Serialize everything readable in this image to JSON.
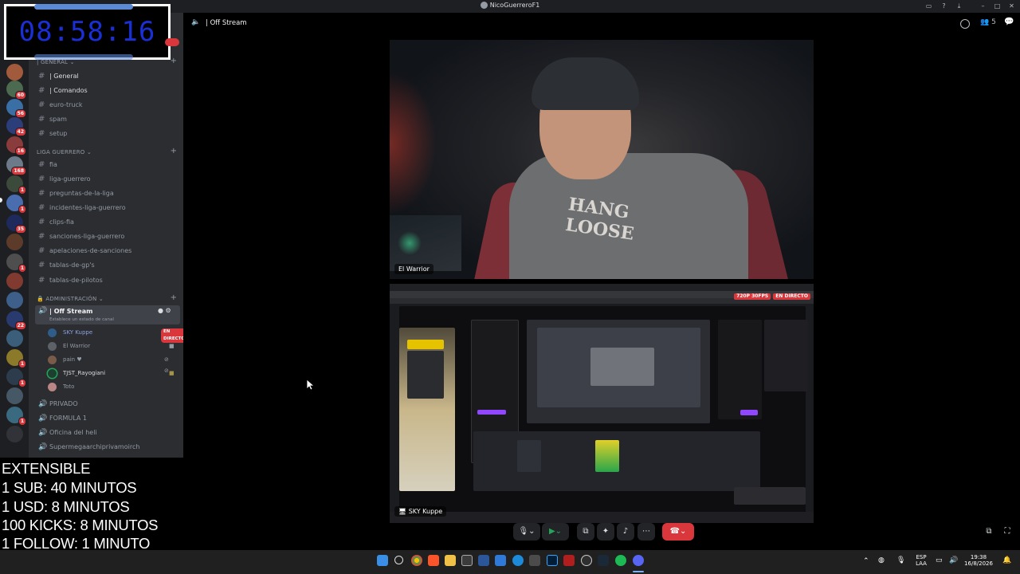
{
  "window": {
    "title": "NicoGuerreroF1"
  },
  "timer_overlay": {
    "time": "08:58:16"
  },
  "subathon_overlay": {
    "lines": [
      "EXTENSIBLE",
      "1 SUB: 40 MINUTOS",
      "1 USD: 8 MINUTOS",
      "100 KICKS: 8 MINUTOS",
      "1 FOLLOW: 1 MINUTO"
    ]
  },
  "server_rail": {
    "badges": [
      "60",
      "56",
      "42",
      "16",
      "168",
      "1",
      "1",
      "35",
      "1",
      "22",
      "1",
      "1",
      "1"
    ]
  },
  "sidebar": {
    "categories": {
      "general": "| GENERAL",
      "liga": "LIGA GUERRERO",
      "admin": "ADMINISTRACIÓN"
    },
    "general_channels": [
      "| General",
      "| Comandos",
      "euro-truck",
      "spam",
      "setup"
    ],
    "liga_channels": [
      "fia",
      "liga-guerrero",
      "preguntas-de-la-liga",
      "incidentes-liga-guerrero",
      "clips-fia",
      "sanciones-liga-guerrero",
      "apelaciones-de-sanciones",
      "tablas-de-gp's",
      "tablas-de-pilotos"
    ],
    "voice_channel": {
      "name": "| Off Stream",
      "status_placeholder": "Establece un estado de canal"
    },
    "voice_users": [
      {
        "name": "SKY Kuppe",
        "live": "EN DIRECTO"
      },
      {
        "name": "El Warrior"
      },
      {
        "name": "pain ♥"
      },
      {
        "name": "TJST_Rayogiani"
      },
      {
        "name": "Toto"
      }
    ],
    "other_voice_channels": [
      "PRIVADO",
      "FORMULA 1",
      "Oficina del heli",
      "Supermegaarchiprivamoirch"
    ]
  },
  "stage": {
    "channel_title": "| Off Stream",
    "user_count": "5",
    "camera_tile": {
      "label": "El Warrior",
      "shirt_text": "HANG LOOSE"
    },
    "screen_tile": {
      "label": "SKY Kuppe",
      "quality_badge": "720P 30FPS",
      "live_badge": "EN DIRECTO"
    }
  },
  "taskbar": {
    "lang": "ESP",
    "lang2": "LAA",
    "time": "19:38",
    "date": "16/8/2026"
  },
  "colors": {
    "blurple": "#5865f2",
    "live_red": "#da373c",
    "green": "#23a55a",
    "timer_blue": "#1a2fd6"
  }
}
